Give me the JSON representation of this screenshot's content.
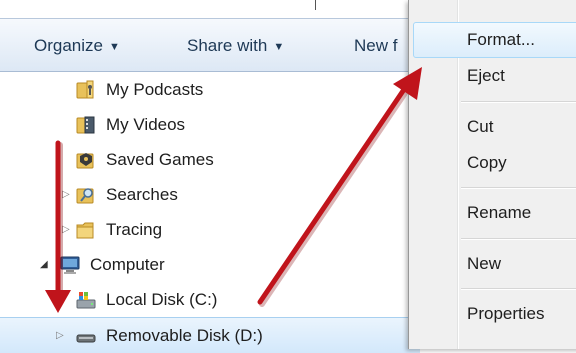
{
  "toolbar": {
    "organize_label": "Organize",
    "share_label": "Share with",
    "newfolder_label": "New f",
    "caret": "▼"
  },
  "tree": {
    "items": [
      {
        "label": "My Podcasts",
        "icon": "podcast-folder-icon"
      },
      {
        "label": "My Videos",
        "icon": "video-folder-icon"
      },
      {
        "label": "Saved Games",
        "icon": "saved-games-icon"
      },
      {
        "label": "Searches",
        "icon": "searches-folder-icon"
      },
      {
        "label": "Tracing",
        "icon": "folder-icon"
      },
      {
        "label": "Computer",
        "icon": "computer-icon"
      },
      {
        "label": "Local Disk (C:)",
        "icon": "local-disk-icon"
      },
      {
        "label": "Removable Disk (D:)",
        "icon": "removable-disk-icon"
      }
    ]
  },
  "context_menu": {
    "items": [
      "Format...",
      "Eject",
      "Cut",
      "Copy",
      "Rename",
      "New",
      "Properties"
    ],
    "highlighted": "Format..."
  },
  "colors": {
    "arrow": "#c0141b",
    "toolbar_text": "#1e3956",
    "highlight_border": "#a8d8f8"
  }
}
